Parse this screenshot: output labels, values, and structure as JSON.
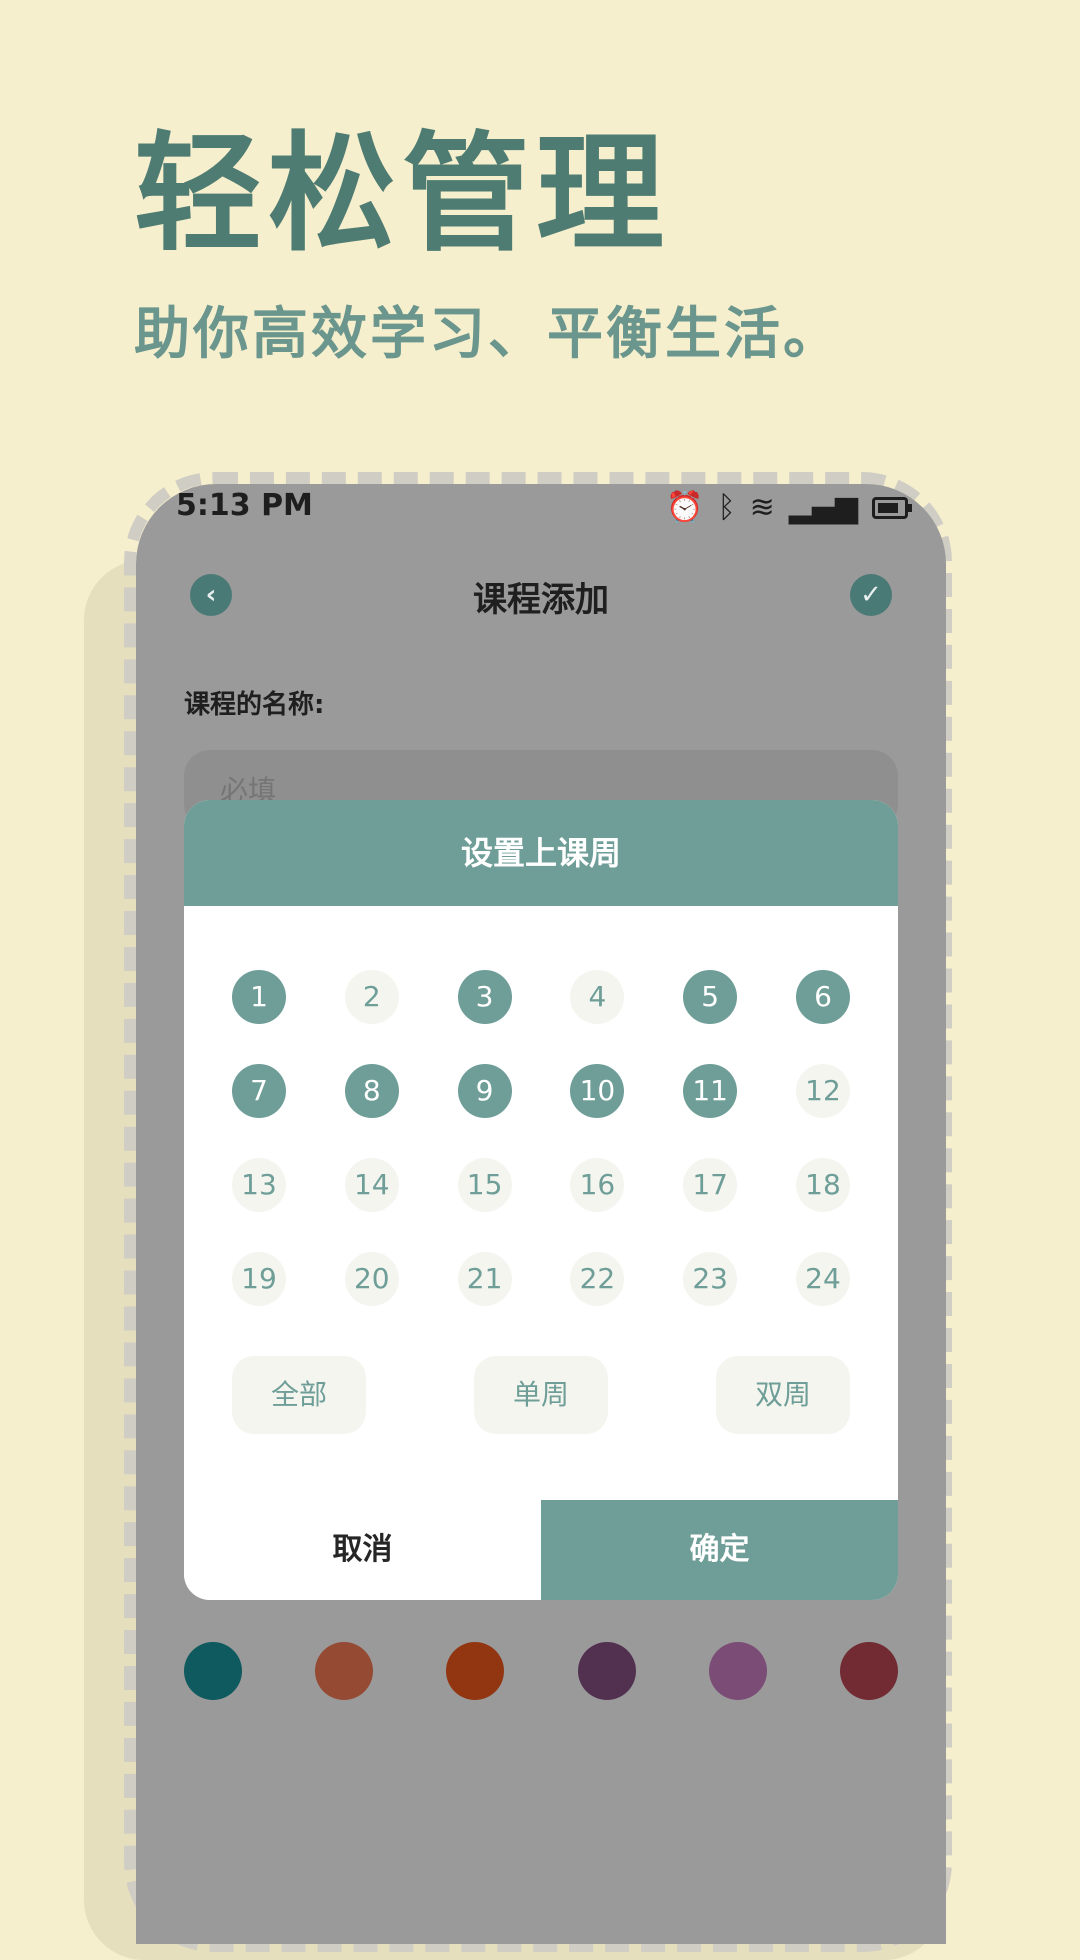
{
  "hero": {
    "title": "轻松管理",
    "subtitle": "助你高效学习、平衡生活。"
  },
  "status_bar": {
    "time": "5:13 PM",
    "icons": [
      "alarm-icon",
      "bluetooth-icon",
      "wifi-icon",
      "signal-icon",
      "battery-icon"
    ]
  },
  "app_bar": {
    "title": "课程添加",
    "back_icon": "chevron-left-icon",
    "confirm_icon": "check-icon"
  },
  "form": {
    "name_label": "课程的名称:",
    "name_placeholder": "必填"
  },
  "dialog": {
    "title": "设置上课周",
    "weeks": [
      {
        "label": "1",
        "selected": true
      },
      {
        "label": "2",
        "selected": false
      },
      {
        "label": "3",
        "selected": true
      },
      {
        "label": "4",
        "selected": false
      },
      {
        "label": "5",
        "selected": true
      },
      {
        "label": "6",
        "selected": true
      },
      {
        "label": "7",
        "selected": true
      },
      {
        "label": "8",
        "selected": true
      },
      {
        "label": "9",
        "selected": true
      },
      {
        "label": "10",
        "selected": true
      },
      {
        "label": "11",
        "selected": true
      },
      {
        "label": "12",
        "selected": false
      },
      {
        "label": "13",
        "selected": false
      },
      {
        "label": "14",
        "selected": false
      },
      {
        "label": "15",
        "selected": false
      },
      {
        "label": "16",
        "selected": false
      },
      {
        "label": "17",
        "selected": false
      },
      {
        "label": "18",
        "selected": false
      },
      {
        "label": "19",
        "selected": false
      },
      {
        "label": "20",
        "selected": false
      },
      {
        "label": "21",
        "selected": false
      },
      {
        "label": "22",
        "selected": false
      },
      {
        "label": "23",
        "selected": false
      },
      {
        "label": "24",
        "selected": false
      }
    ],
    "quick_select": {
      "all": "全部",
      "odd": "单周",
      "even": "双周"
    },
    "cancel": "取消",
    "ok": "确定"
  },
  "colors": {
    "accent": "#6e9e97",
    "swatches": [
      "#0e5a5f",
      "#954a34",
      "#923611",
      "#51314f",
      "#7b4d76",
      "#722b32"
    ]
  }
}
